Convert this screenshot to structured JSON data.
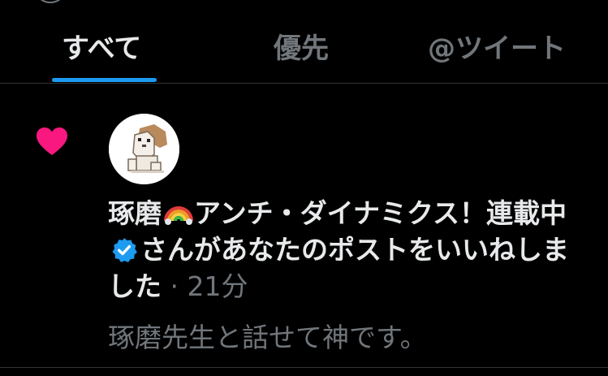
{
  "tabs": [
    {
      "label": "すべて",
      "active": true
    },
    {
      "label": "優先",
      "active": false
    },
    {
      "label": "@ツイート",
      "active": false
    }
  ],
  "notification": {
    "type_icon": "heart-icon",
    "actor_name": "琢磨",
    "actor_name_suffix": "アンチ・ダイナミクス！連載中",
    "actor_verified": true,
    "action_text": "さんがあなたのポストをいいねしました",
    "separator": "·",
    "time": "21分",
    "post_preview": "琢磨先生と話せて神です。"
  },
  "colors": {
    "background": "#000000",
    "accent": "#1d9bf0",
    "like": "#f91880",
    "text_primary": "#e7e9ea",
    "text_secondary": "#71767b",
    "divider": "#2f3336"
  }
}
